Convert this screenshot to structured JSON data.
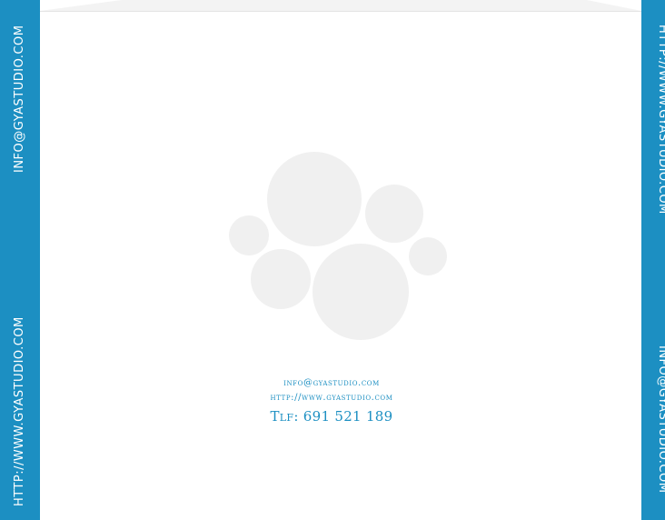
{
  "left_bar": {
    "email": "INFO@GYASTUDIO.COM",
    "website": "HTTP://WWW.GYASTUDIO.COM"
  },
  "right_bar": {
    "website": "HTTP://WWW.GYASTUDIO.COM",
    "email": "INFO@GYASTUDIO.COM"
  },
  "contact": {
    "email": "info@gyastudio.com",
    "website": "http://www.gyastudio.com",
    "phone": "Tlf: 691 521 189"
  },
  "colors": {
    "accent": "#1c8fc2",
    "logo_gray": "#f0f0f0",
    "background": "#ffffff"
  },
  "logo": {
    "icon": "paw-print-icon"
  }
}
